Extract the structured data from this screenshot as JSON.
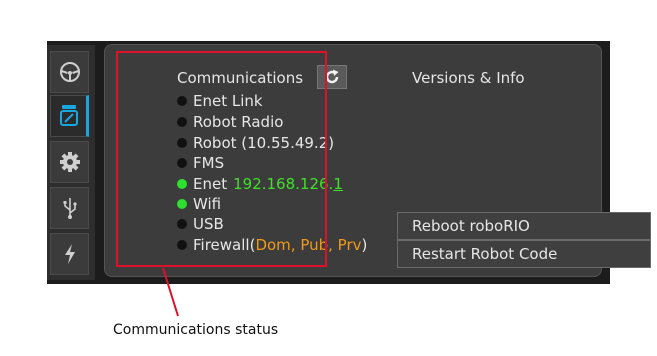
{
  "sidebar": {
    "items": [
      {
        "icon": "steering-wheel-icon",
        "active": false
      },
      {
        "icon": "robot-communication-icon",
        "active": true
      },
      {
        "icon": "gear-icon",
        "active": false
      },
      {
        "icon": "usb-icon",
        "active": false
      },
      {
        "icon": "lightning-icon",
        "active": false
      }
    ]
  },
  "communications": {
    "title": "Communications",
    "refresh_icon": "refresh-icon",
    "rows": [
      {
        "label": "Enet Link",
        "status": "off"
      },
      {
        "label": "Robot Radio",
        "status": "off"
      },
      {
        "label": "Robot (10.55.49.2)",
        "status": "off"
      },
      {
        "label": "FMS",
        "status": "off"
      },
      {
        "label": "Enet",
        "ip_prefix": "192.168.126.",
        "ip_suffix": "1",
        "status": "on"
      },
      {
        "label": "Wifi",
        "status": "on"
      },
      {
        "label": "USB",
        "status": "off"
      },
      {
        "label": "Firewall",
        "paren_open": "(",
        "detail": "Dom, Pub, Prv",
        "paren_close": ")",
        "status": "off"
      }
    ]
  },
  "versions": {
    "title": "Versions & Info"
  },
  "actions": {
    "reboot": "Reboot roboRIO",
    "restart": "Restart Robot Code"
  },
  "annotation": {
    "caption": "Communications status",
    "color": "#e0102a"
  },
  "colors": {
    "led_on": "#2ee02e",
    "ip_text": "#40e02a",
    "firewall_detail": "#f09a1a",
    "accent": "#19a7e0"
  }
}
